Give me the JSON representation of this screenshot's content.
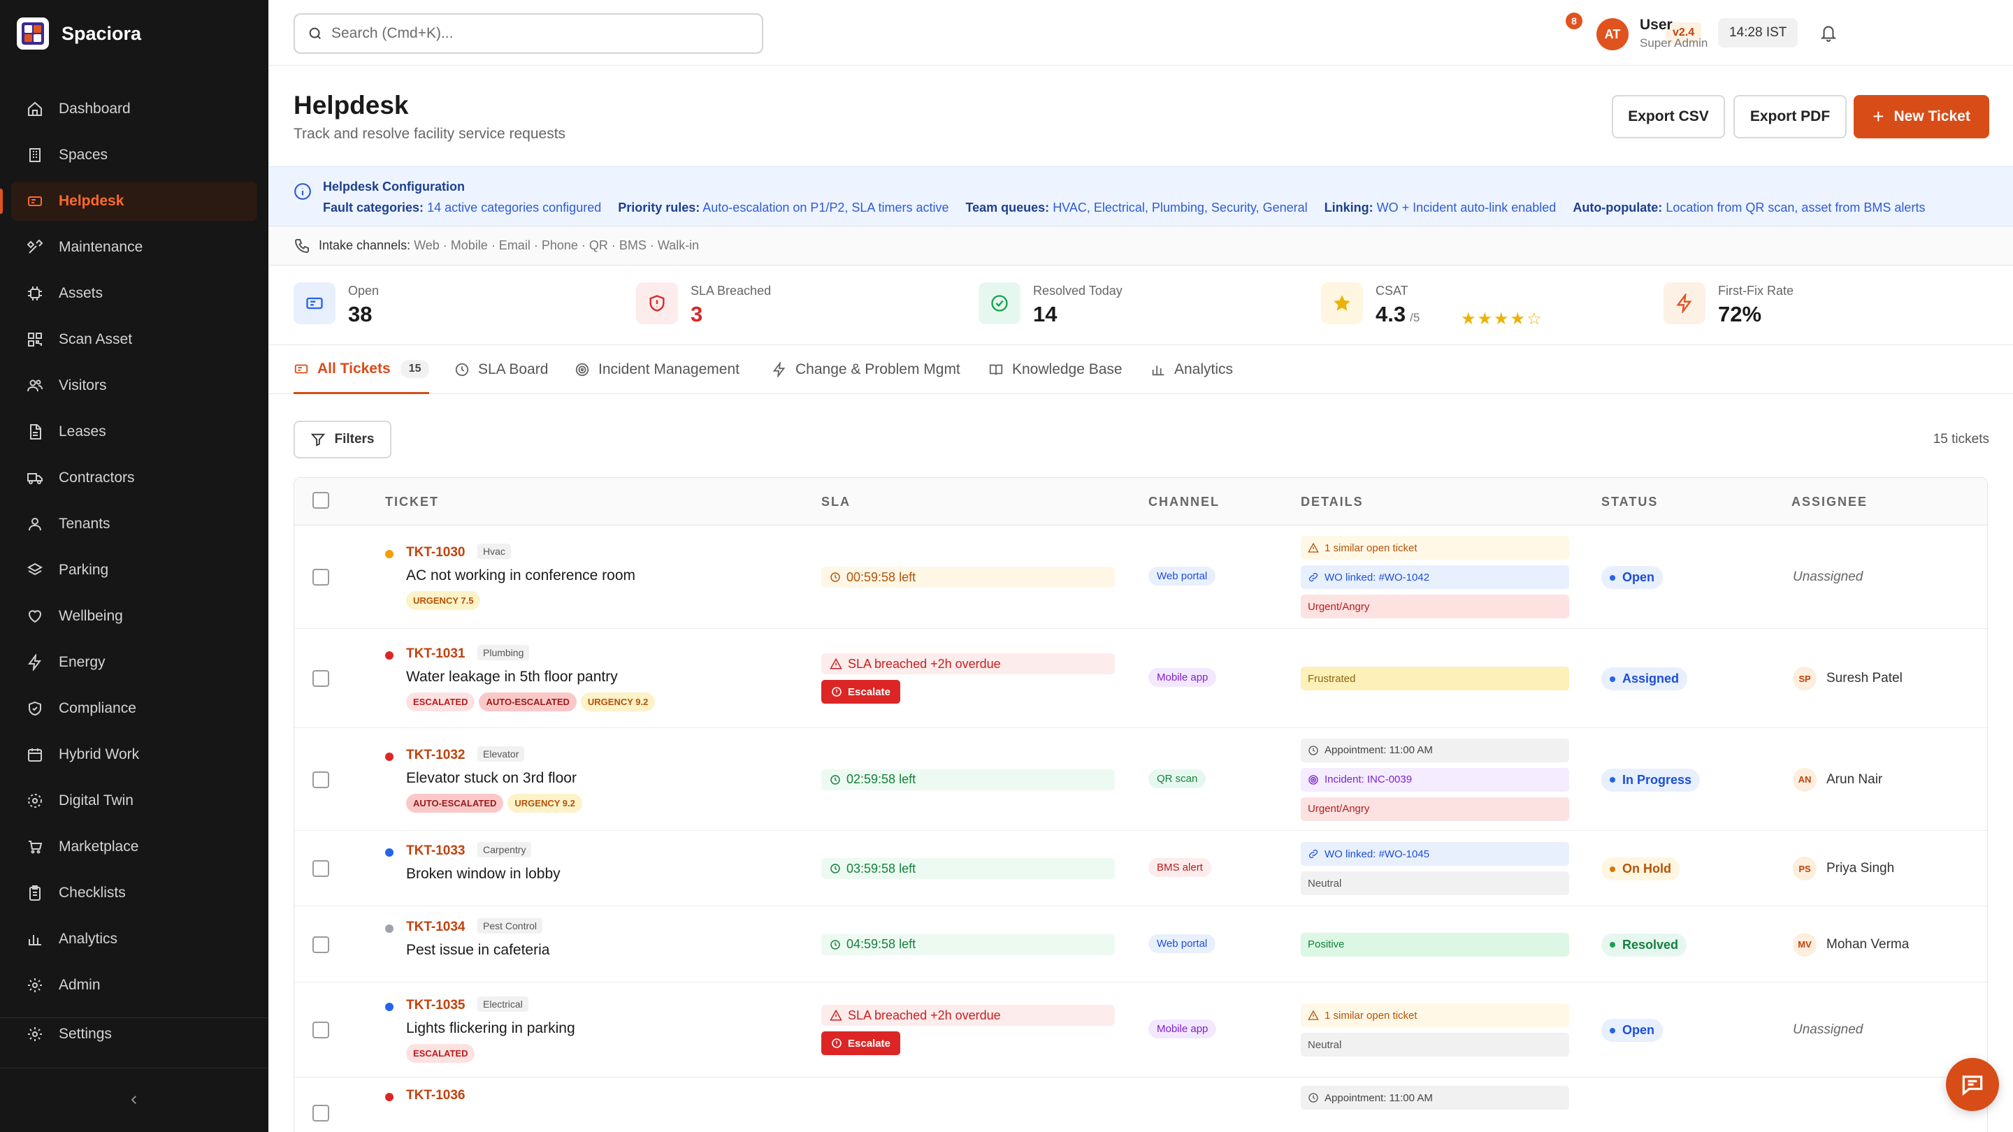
{
  "app": {
    "name": "Spaciora"
  },
  "sidebar": {
    "items": [
      {
        "label": "Dashboard",
        "icon": "home-icon"
      },
      {
        "label": "Spaces",
        "icon": "building-icon"
      },
      {
        "label": "Helpdesk",
        "icon": "ticket-icon",
        "active": true
      },
      {
        "label": "Maintenance",
        "icon": "wrench-icon"
      },
      {
        "label": "Assets",
        "icon": "chip-icon"
      },
      {
        "label": "Scan Asset",
        "icon": "qr-icon"
      },
      {
        "label": "Visitors",
        "icon": "users-icon"
      },
      {
        "label": "Leases",
        "icon": "file-icon"
      },
      {
        "label": "Contractors",
        "icon": "truck-icon"
      },
      {
        "label": "Tenants",
        "icon": "user-icon"
      },
      {
        "label": "Parking",
        "icon": "layers-icon"
      },
      {
        "label": "Wellbeing",
        "icon": "heart-icon"
      },
      {
        "label": "Energy",
        "icon": "bolt-icon"
      },
      {
        "label": "Compliance",
        "icon": "shield-icon"
      },
      {
        "label": "Hybrid Work",
        "icon": "calendar-icon"
      },
      {
        "label": "Digital Twin",
        "icon": "cube-icon"
      },
      {
        "label": "Marketplace",
        "icon": "cart-icon"
      },
      {
        "label": "Checklists",
        "icon": "clipboard-icon"
      },
      {
        "label": "Analytics",
        "icon": "bar-chart-icon"
      },
      {
        "label": "Admin",
        "icon": "gear-icon"
      }
    ],
    "settings_label": "Settings"
  },
  "topbar": {
    "search_placeholder": "Search (Cmd+K)...",
    "version": "v2.4",
    "time": "14:28 IST",
    "notification_count": "8",
    "user_initials": "AT",
    "user_name": "User",
    "user_role": "Super Admin"
  },
  "header": {
    "title": "Helpdesk",
    "subtitle": "Track and resolve facility service requests",
    "export_csv": "Export CSV",
    "export_pdf": "Export PDF",
    "new_ticket": "New Ticket"
  },
  "config": {
    "title": "Helpdesk Configuration",
    "items": [
      {
        "key": "Fault categories:",
        "value": "14 active categories configured"
      },
      {
        "key": "Priority rules:",
        "value": "Auto-escalation on P1/P2, SLA timers active"
      },
      {
        "key": "Team queues:",
        "value": "HVAC, Electrical, Plumbing, Security, General"
      },
      {
        "key": "Linking:",
        "value": "WO + Incident auto-link enabled"
      },
      {
        "key": "Auto-populate:",
        "value": "Location from QR scan, asset from BMS alerts"
      }
    ],
    "intake_label": "Intake channels:",
    "intake_value": "Web · Mobile · Email · Phone · QR · BMS · Walk-in"
  },
  "kpis": [
    {
      "label": "Open",
      "value": "38",
      "icon": "ticket-icon"
    },
    {
      "label": "SLA Breached",
      "value": "3",
      "icon": "shield-alert-icon"
    },
    {
      "label": "Resolved Today",
      "value": "14",
      "icon": "check-circle-icon"
    },
    {
      "label": "CSAT",
      "value": "4.3",
      "unit": "/5",
      "rating": 4,
      "icon": "star-icon"
    },
    {
      "label": "First-Fix Rate",
      "value": "72%",
      "icon": "bolt-icon"
    }
  ],
  "tabs": [
    {
      "label": "All Tickets",
      "count": "15",
      "icon": "ticket-icon"
    },
    {
      "label": "SLA Board",
      "icon": "clock-icon"
    },
    {
      "label": "Incident Management",
      "icon": "target-icon"
    },
    {
      "label": "Change & Problem Mgmt",
      "icon": "bolt-icon"
    },
    {
      "label": "Knowledge Base",
      "icon": "book-icon"
    },
    {
      "label": "Analytics",
      "icon": "bar-chart-icon"
    }
  ],
  "toolbar": {
    "filters_label": "Filters",
    "count_text": "15 tickets"
  },
  "table": {
    "columns": [
      "TICKET",
      "SLA",
      "CHANNEL",
      "DETAILS",
      "STATUS",
      "ASSIGNEE"
    ],
    "rows": [
      {
        "id": "TKT-1030",
        "category": "Hvac",
        "title": "AC not working in conference room",
        "dot": "#f59e0b",
        "tags": [
          {
            "text": "URGENCY 7.5",
            "kind": "urgency"
          }
        ],
        "sla": {
          "text": "00:59:58 left",
          "kind": "warn"
        },
        "channel": {
          "text": "Web portal",
          "kind": "web"
        },
        "details": [
          {
            "text": "1 similar open ticket",
            "kind": "similar"
          },
          {
            "text": "WO linked: #WO-1042",
            "kind": "wo"
          },
          {
            "text": "Urgent/Angry",
            "kind": "urgent"
          }
        ],
        "status": {
          "text": "Open",
          "kind": "open"
        },
        "assignee": {
          "name": "Unassigned"
        }
      },
      {
        "id": "TKT-1031",
        "category": "Plumbing",
        "title": "Water leakage in 5th floor pantry",
        "dot": "#dc2626",
        "tags": [
          {
            "text": "ESCALATED",
            "kind": "esc"
          },
          {
            "text": "AUTO-ESCALATED",
            "kind": "auto"
          },
          {
            "text": "URGENCY 9.2",
            "kind": "urgency"
          }
        ],
        "sla": {
          "text": "SLA breached +2h overdue",
          "kind": "bad"
        },
        "escalate": "Escalate",
        "channel": {
          "text": "Mobile app",
          "kind": "mob"
        },
        "details": [
          {
            "text": "Frustrated",
            "kind": "frustrated"
          }
        ],
        "status": {
          "text": "Assigned",
          "kind": "assigned"
        },
        "assignee": {
          "initials": "SP",
          "name": "Suresh Patel"
        }
      },
      {
        "id": "TKT-1032",
        "category": "Elevator",
        "title": "Elevator stuck on 3rd floor",
        "dot": "#dc2626",
        "tags": [
          {
            "text": "AUTO-ESCALATED",
            "kind": "auto"
          },
          {
            "text": "URGENCY 9.2",
            "kind": "urgency"
          }
        ],
        "sla": {
          "text": "02:59:58 left",
          "kind": "ok"
        },
        "channel": {
          "text": "QR scan",
          "kind": "qr"
        },
        "details": [
          {
            "text": "Appointment: 11:00 AM",
            "kind": "appt"
          },
          {
            "text": "Incident: INC-0039",
            "kind": "inc"
          },
          {
            "text": "Urgent/Angry",
            "kind": "urgent"
          }
        ],
        "status": {
          "text": "In Progress",
          "kind": "progress"
        },
        "assignee": {
          "initials": "AN",
          "name": "Arun Nair"
        }
      },
      {
        "id": "TKT-1033",
        "category": "Carpentry",
        "title": "Broken window in lobby",
        "dot": "#2563eb",
        "tags": [],
        "sla": {
          "text": "03:59:58 left",
          "kind": "ok"
        },
        "channel": {
          "text": "BMS alert",
          "kind": "bms"
        },
        "details": [
          {
            "text": "WO linked: #WO-1045",
            "kind": "wo"
          },
          {
            "text": "Neutral",
            "kind": "neutral"
          }
        ],
        "status": {
          "text": "On Hold",
          "kind": "hold"
        },
        "assignee": {
          "initials": "PS",
          "name": "Priya Singh"
        }
      },
      {
        "id": "TKT-1034",
        "category": "Pest Control",
        "title": "Pest issue in cafeteria",
        "dot": "#9ca3af",
        "tags": [],
        "sla": {
          "text": "04:59:58 left",
          "kind": "ok"
        },
        "channel": {
          "text": "Web portal",
          "kind": "web"
        },
        "details": [
          {
            "text": "Positive",
            "kind": "positive"
          }
        ],
        "status": {
          "text": "Resolved",
          "kind": "resolved"
        },
        "assignee": {
          "initials": "MV",
          "name": "Mohan Verma"
        }
      },
      {
        "id": "TKT-1035",
        "category": "Electrical",
        "title": "Lights flickering in parking",
        "dot": "#2563eb",
        "tags": [
          {
            "text": "ESCALATED",
            "kind": "esc"
          }
        ],
        "sla": {
          "text": "SLA breached +2h overdue",
          "kind": "bad"
        },
        "escalate": "Escalate",
        "channel": {
          "text": "Mobile app",
          "kind": "mob"
        },
        "details": [
          {
            "text": "1 similar open ticket",
            "kind": "similar"
          },
          {
            "text": "Neutral",
            "kind": "neutral"
          }
        ],
        "status": {
          "text": "Open",
          "kind": "open"
        },
        "assignee": {
          "name": "Unassigned"
        }
      },
      {
        "id": "TKT-1036",
        "category": "",
        "title": "",
        "dot": "#dc2626",
        "tags": [],
        "details": [
          {
            "text": "Appointment: 11:00 AM",
            "kind": "appt"
          }
        ]
      }
    ]
  }
}
